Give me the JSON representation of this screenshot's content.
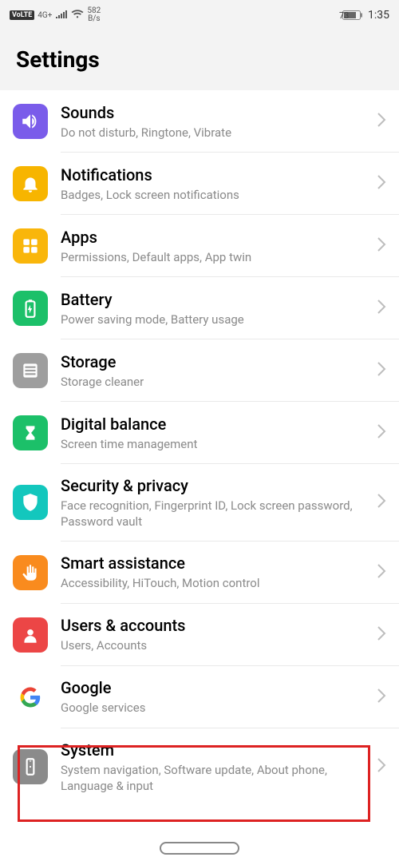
{
  "status": {
    "volte": "VoLTE",
    "net": "4G+",
    "speed_num": "582",
    "speed_unit": "B/s",
    "battery": "73",
    "clock": "1:35"
  },
  "header": {
    "title": "Settings"
  },
  "items": [
    {
      "title": "Sounds",
      "sub": "Do not disturb, Ringtone, Vibrate"
    },
    {
      "title": "Notifications",
      "sub": "Badges, Lock screen notifications"
    },
    {
      "title": "Apps",
      "sub": "Permissions, Default apps, App twin"
    },
    {
      "title": "Battery",
      "sub": "Power saving mode, Battery usage"
    },
    {
      "title": "Storage",
      "sub": "Storage cleaner"
    },
    {
      "title": "Digital balance",
      "sub": "Screen time management"
    },
    {
      "title": "Security & privacy",
      "sub": "Face recognition, Fingerprint ID, Lock screen password, Password vault"
    },
    {
      "title": "Smart assistance",
      "sub": "Accessibility, HiTouch, Motion control"
    },
    {
      "title": "Users & accounts",
      "sub": "Users, Accounts"
    },
    {
      "title": "Google",
      "sub": "Google services"
    },
    {
      "title": "System",
      "sub": "System navigation, Software update, About phone, Language & input"
    }
  ]
}
